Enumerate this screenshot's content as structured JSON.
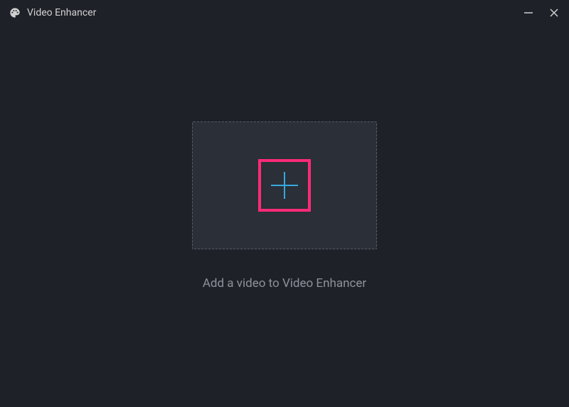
{
  "window": {
    "title": "Video Enhancer"
  },
  "main": {
    "instruction": "Add a video to Video Enhancer"
  },
  "icons": {
    "app": "palette-icon",
    "minimize": "minimize-icon",
    "close": "close-icon",
    "add": "plus-icon"
  },
  "colors": {
    "highlight": "#ff2a77",
    "plus": "#35a9dd",
    "background": "#1e2128",
    "dropzone": "#2b2f38",
    "dashedBorder": "#565a66",
    "textMuted": "#8e929c",
    "textTitle": "#d0d0d0"
  }
}
